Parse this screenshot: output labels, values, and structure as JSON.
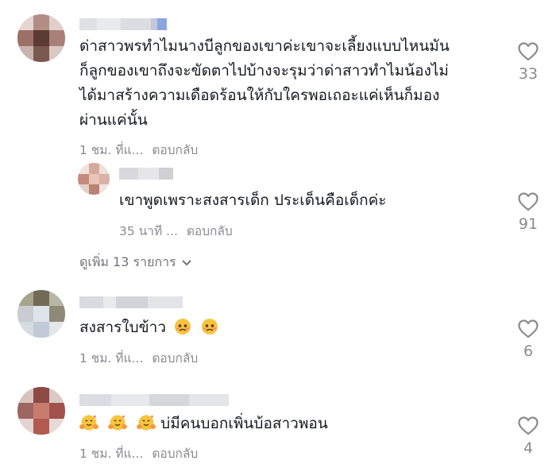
{
  "comments": [
    {
      "text_lines": [
        "ด่าสาวพรทำไมนางบีลูกของเขาค่ะเขาจะเลี้ยงแบบไหนมัน",
        "ก็ลูกของเขาถึงจะขัดตาไปบ้างจะรุมว่าด่าสาวทำไมน้องไม่",
        "ได้มาสร้างความเดือดร้อนให้กับใครพอเถอะแค่เห็นก็มอง",
        "ผ่านแค่นั้น"
      ],
      "time": "1 ชม. ที่แ...",
      "reply_label": "ตอบกลับ",
      "likes": "33",
      "replies": [
        {
          "text": "เขาพูดเพราะสงสารเด็ก ประเด็นคือเด็กค่ะ",
          "time": "35 นาที ...",
          "reply_label": "ตอบกลับ",
          "likes": "91"
        }
      ],
      "view_more": "ดูเพิ่ม 13 รายการ"
    },
    {
      "text": "สงสารใบข้าว",
      "emoji": "sad-face",
      "time": "1 ชม. ที่แ...",
      "reply_label": "ตอบกลับ",
      "likes": "6"
    },
    {
      "text": "บ่มีคนบอกเพิ่นบ้อสาวพอน",
      "emoji": "hugging-face",
      "time": "1 ชม. ที่แ...",
      "reply_label": "ตอบกลับ",
      "likes": "4"
    }
  ],
  "colors": {
    "text": "#161823",
    "meta": "#8a8b91",
    "heart": "#8a8b91"
  }
}
